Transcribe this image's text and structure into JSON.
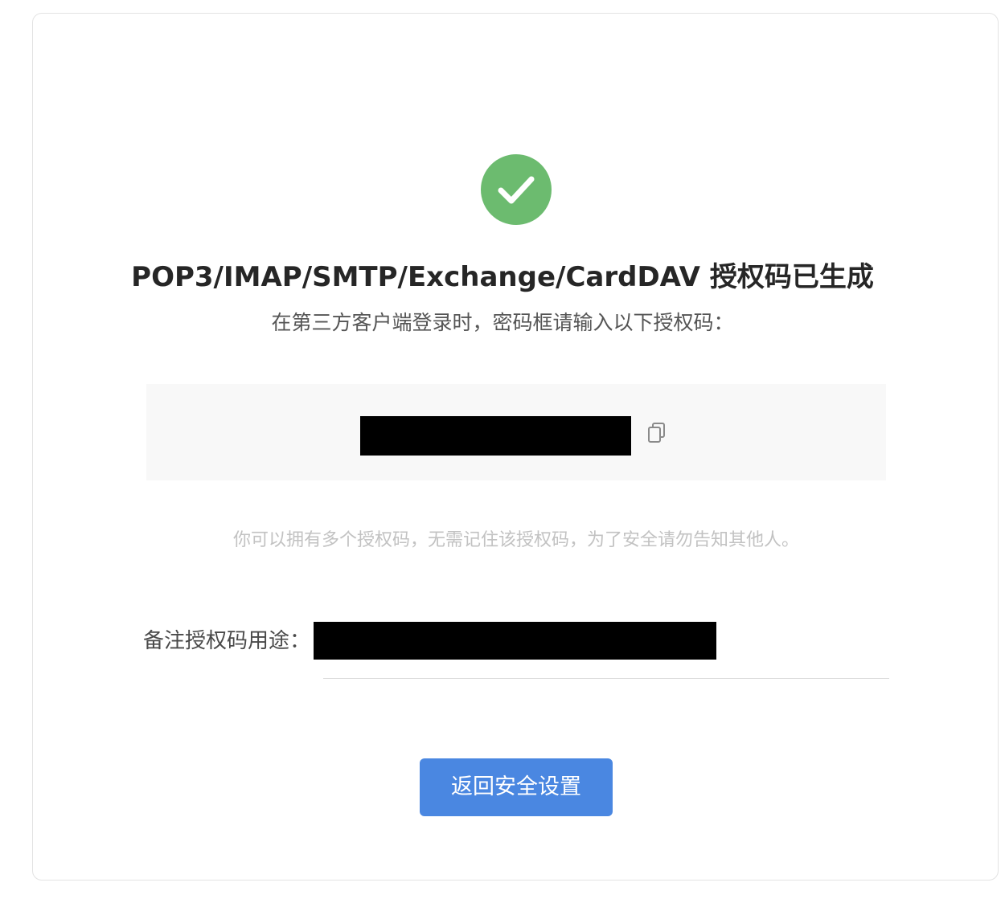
{
  "status": {
    "icon": "check-circle-icon",
    "color": "#6cbb6f"
  },
  "heading": {
    "title": "POP3/IMAP/SMTP/Exchange/CardDAV 授权码已生成",
    "subtitle": "在第三方客户端登录时，密码框请输入以下授权码："
  },
  "auth_code": {
    "value": "",
    "redacted": true,
    "copy_icon": "copy-icon"
  },
  "hint": "你可以拥有多个授权码，无需记住该授权码，为了安全请勿告知其他人。",
  "remark": {
    "label": "备注授权码用途：",
    "value": "",
    "redacted": true
  },
  "actions": {
    "back_label": "返回安全设置",
    "back_color": "#4a87e1"
  }
}
